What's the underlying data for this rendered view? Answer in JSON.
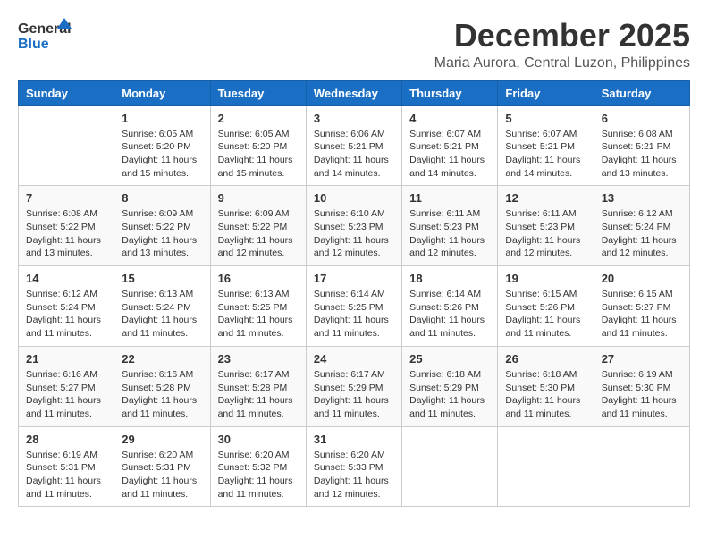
{
  "header": {
    "logo_general": "General",
    "logo_blue": "Blue",
    "month_title": "December 2025",
    "location": "Maria Aurora, Central Luzon, Philippines"
  },
  "calendar": {
    "days_of_week": [
      "Sunday",
      "Monday",
      "Tuesday",
      "Wednesday",
      "Thursday",
      "Friday",
      "Saturday"
    ],
    "weeks": [
      [
        {
          "day": "",
          "info": ""
        },
        {
          "day": "1",
          "info": "Sunrise: 6:05 AM\nSunset: 5:20 PM\nDaylight: 11 hours\nand 15 minutes."
        },
        {
          "day": "2",
          "info": "Sunrise: 6:05 AM\nSunset: 5:20 PM\nDaylight: 11 hours\nand 15 minutes."
        },
        {
          "day": "3",
          "info": "Sunrise: 6:06 AM\nSunset: 5:21 PM\nDaylight: 11 hours\nand 14 minutes."
        },
        {
          "day": "4",
          "info": "Sunrise: 6:07 AM\nSunset: 5:21 PM\nDaylight: 11 hours\nand 14 minutes."
        },
        {
          "day": "5",
          "info": "Sunrise: 6:07 AM\nSunset: 5:21 PM\nDaylight: 11 hours\nand 14 minutes."
        },
        {
          "day": "6",
          "info": "Sunrise: 6:08 AM\nSunset: 5:21 PM\nDaylight: 11 hours\nand 13 minutes."
        }
      ],
      [
        {
          "day": "7",
          "info": "Sunrise: 6:08 AM\nSunset: 5:22 PM\nDaylight: 11 hours\nand 13 minutes."
        },
        {
          "day": "8",
          "info": "Sunrise: 6:09 AM\nSunset: 5:22 PM\nDaylight: 11 hours\nand 13 minutes."
        },
        {
          "day": "9",
          "info": "Sunrise: 6:09 AM\nSunset: 5:22 PM\nDaylight: 11 hours\nand 12 minutes."
        },
        {
          "day": "10",
          "info": "Sunrise: 6:10 AM\nSunset: 5:23 PM\nDaylight: 11 hours\nand 12 minutes."
        },
        {
          "day": "11",
          "info": "Sunrise: 6:11 AM\nSunset: 5:23 PM\nDaylight: 11 hours\nand 12 minutes."
        },
        {
          "day": "12",
          "info": "Sunrise: 6:11 AM\nSunset: 5:23 PM\nDaylight: 11 hours\nand 12 minutes."
        },
        {
          "day": "13",
          "info": "Sunrise: 6:12 AM\nSunset: 5:24 PM\nDaylight: 11 hours\nand 12 minutes."
        }
      ],
      [
        {
          "day": "14",
          "info": "Sunrise: 6:12 AM\nSunset: 5:24 PM\nDaylight: 11 hours\nand 11 minutes."
        },
        {
          "day": "15",
          "info": "Sunrise: 6:13 AM\nSunset: 5:24 PM\nDaylight: 11 hours\nand 11 minutes."
        },
        {
          "day": "16",
          "info": "Sunrise: 6:13 AM\nSunset: 5:25 PM\nDaylight: 11 hours\nand 11 minutes."
        },
        {
          "day": "17",
          "info": "Sunrise: 6:14 AM\nSunset: 5:25 PM\nDaylight: 11 hours\nand 11 minutes."
        },
        {
          "day": "18",
          "info": "Sunrise: 6:14 AM\nSunset: 5:26 PM\nDaylight: 11 hours\nand 11 minutes."
        },
        {
          "day": "19",
          "info": "Sunrise: 6:15 AM\nSunset: 5:26 PM\nDaylight: 11 hours\nand 11 minutes."
        },
        {
          "day": "20",
          "info": "Sunrise: 6:15 AM\nSunset: 5:27 PM\nDaylight: 11 hours\nand 11 minutes."
        }
      ],
      [
        {
          "day": "21",
          "info": "Sunrise: 6:16 AM\nSunset: 5:27 PM\nDaylight: 11 hours\nand 11 minutes."
        },
        {
          "day": "22",
          "info": "Sunrise: 6:16 AM\nSunset: 5:28 PM\nDaylight: 11 hours\nand 11 minutes."
        },
        {
          "day": "23",
          "info": "Sunrise: 6:17 AM\nSunset: 5:28 PM\nDaylight: 11 hours\nand 11 minutes."
        },
        {
          "day": "24",
          "info": "Sunrise: 6:17 AM\nSunset: 5:29 PM\nDaylight: 11 hours\nand 11 minutes."
        },
        {
          "day": "25",
          "info": "Sunrise: 6:18 AM\nSunset: 5:29 PM\nDaylight: 11 hours\nand 11 minutes."
        },
        {
          "day": "26",
          "info": "Sunrise: 6:18 AM\nSunset: 5:30 PM\nDaylight: 11 hours\nand 11 minutes."
        },
        {
          "day": "27",
          "info": "Sunrise: 6:19 AM\nSunset: 5:30 PM\nDaylight: 11 hours\nand 11 minutes."
        }
      ],
      [
        {
          "day": "28",
          "info": "Sunrise: 6:19 AM\nSunset: 5:31 PM\nDaylight: 11 hours\nand 11 minutes."
        },
        {
          "day": "29",
          "info": "Sunrise: 6:20 AM\nSunset: 5:31 PM\nDaylight: 11 hours\nand 11 minutes."
        },
        {
          "day": "30",
          "info": "Sunrise: 6:20 AM\nSunset: 5:32 PM\nDaylight: 11 hours\nand 11 minutes."
        },
        {
          "day": "31",
          "info": "Sunrise: 6:20 AM\nSunset: 5:33 PM\nDaylight: 11 hours\nand 12 minutes."
        },
        {
          "day": "",
          "info": ""
        },
        {
          "day": "",
          "info": ""
        },
        {
          "day": "",
          "info": ""
        }
      ]
    ]
  }
}
